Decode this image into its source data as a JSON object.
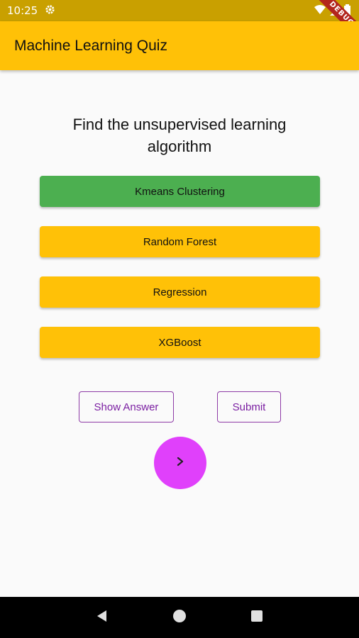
{
  "status_bar": {
    "time": "10:25",
    "icons": [
      "gear-icon",
      "wifi-icon",
      "signal-icon",
      "battery-icon"
    ],
    "debug_label": "DEBUG"
  },
  "app_bar": {
    "title": "Machine Learning Quiz",
    "color": "#ffc107"
  },
  "quiz": {
    "question": "Find the unsupervised learning algorithm",
    "options": [
      {
        "label": "Kmeans Clustering",
        "state": "correct",
        "color": "#4caf50"
      },
      {
        "label": "Random Forest",
        "state": "default",
        "color": "#ffc107"
      },
      {
        "label": "Regression",
        "state": "default",
        "color": "#ffc107"
      },
      {
        "label": "XGBoost",
        "state": "default",
        "color": "#ffc107"
      }
    ],
    "show_answer_label": "Show Answer",
    "submit_label": "Submit",
    "next_icon": "chevron-right-icon",
    "next_color": "#e040fb"
  },
  "nav_bar": {
    "icons": [
      "back-icon",
      "home-icon",
      "recents-icon"
    ]
  }
}
